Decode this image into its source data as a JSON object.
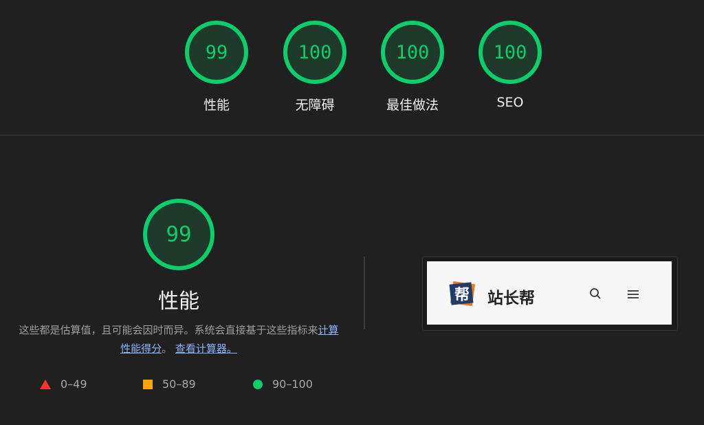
{
  "top_scores": [
    {
      "value": "99",
      "label": "性能",
      "score": 99
    },
    {
      "value": "100",
      "label": "无障碍",
      "score": 100
    },
    {
      "value": "100",
      "label": "最佳做法",
      "score": 100
    },
    {
      "value": "100",
      "label": "SEO",
      "score": 100
    }
  ],
  "performance": {
    "value": "99",
    "score": 99,
    "title": "性能",
    "desc_text": "这些都是估算值，且可能会因时而异。系统会直接基于这些指标来",
    "desc_link1": "计算性能得分",
    "desc_sep": "。",
    "desc_link2": "查看计算器。"
  },
  "legend": [
    {
      "label": "0–49",
      "shape": "triangle",
      "color": "#ff3333"
    },
    {
      "label": "50–89",
      "shape": "square",
      "color": "#ffa400"
    },
    {
      "label": "90–100",
      "shape": "circle",
      "color": "#0cce6b"
    }
  ],
  "preview": {
    "site_name": "站长帮",
    "logo_char": "帮",
    "search_icon": "search-icon",
    "menu_icon": "menu-icon"
  },
  "colors": {
    "pass": "#0cce6b",
    "average": "#ffa400",
    "fail": "#ff3333",
    "background": "#202020"
  }
}
